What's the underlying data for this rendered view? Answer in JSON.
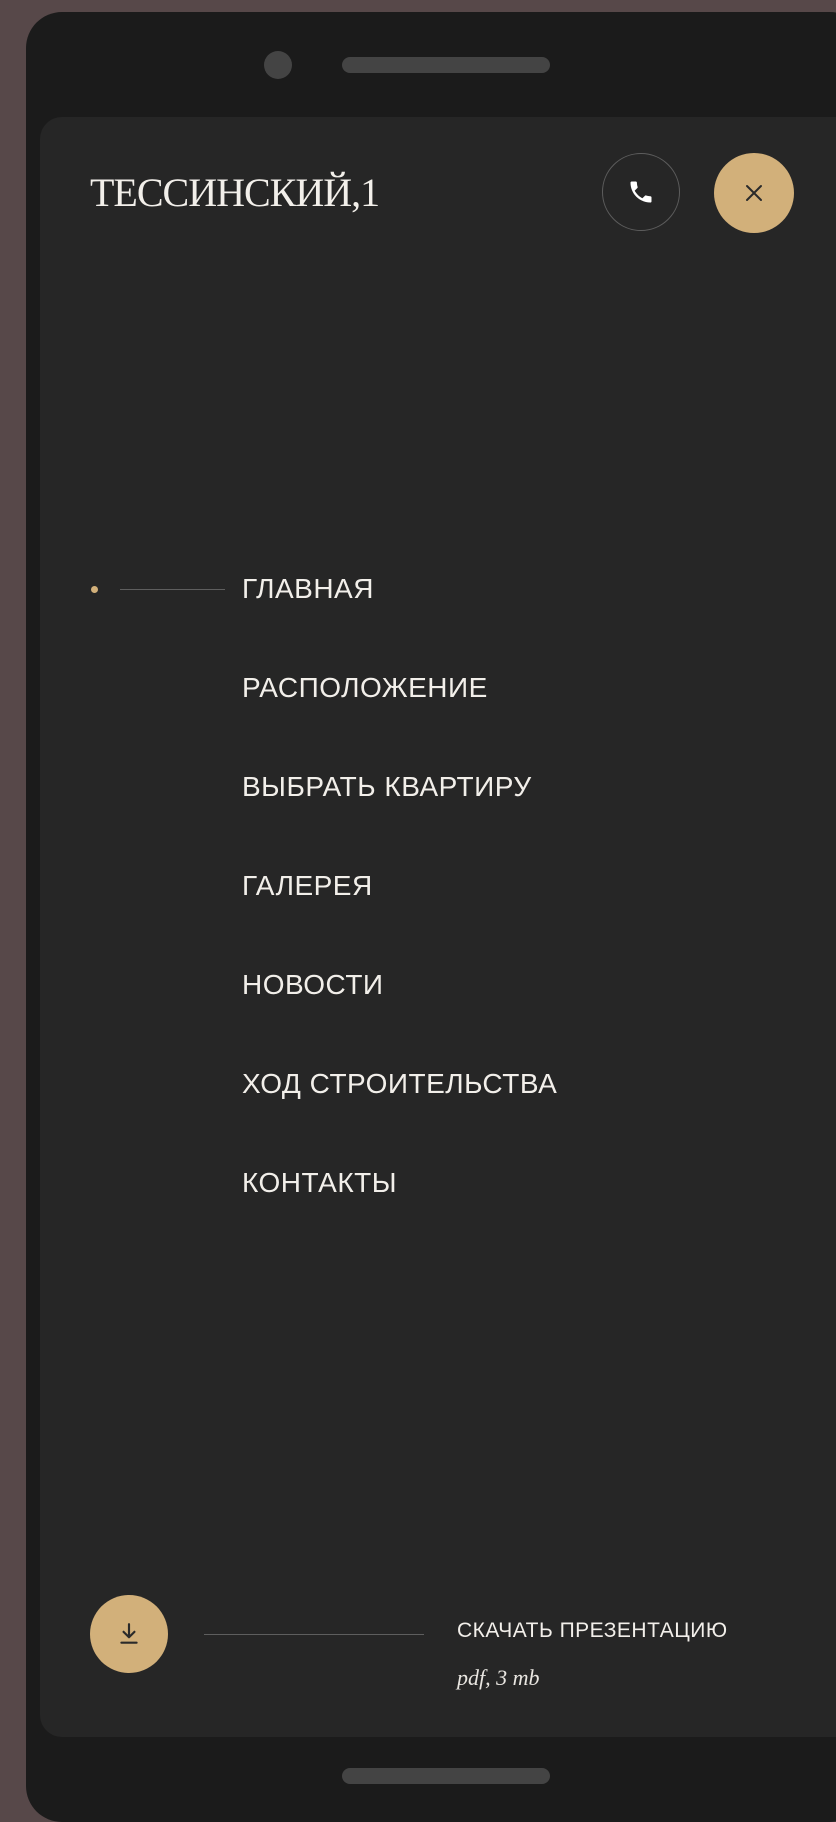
{
  "header": {
    "logo": "ТЕССИНСКИЙ,1",
    "call_icon": "phone-icon",
    "close_icon": "close-icon"
  },
  "menu": {
    "active_index": 0,
    "items": [
      {
        "label": "ГЛАВНАЯ"
      },
      {
        "label": "РАСПОЛОЖЕНИЕ"
      },
      {
        "label": "ВЫБРАТЬ КВАРТИРУ"
      },
      {
        "label": "ГАЛЕРЕЯ"
      },
      {
        "label": "НОВОСТИ"
      },
      {
        "label": "ХОД СТРОИТЕЛЬСТВА"
      },
      {
        "label": "КОНТАКТЫ"
      }
    ]
  },
  "download": {
    "icon": "download-icon",
    "label": "СКАЧАТЬ ПРЕЗЕНТАЦИЮ",
    "meta": "pdf, 3 mb"
  },
  "colors": {
    "accent": "#d2b07a",
    "background": "#262626",
    "text": "#f2efea"
  }
}
